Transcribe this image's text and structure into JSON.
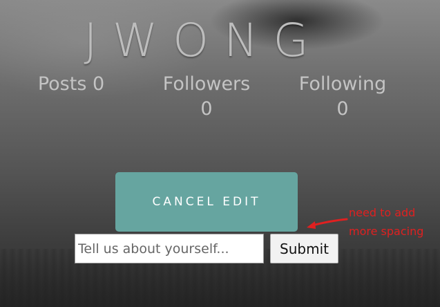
{
  "profile": {
    "username": "JWONG"
  },
  "stats": {
    "posts": {
      "label": "Posts",
      "value": "0"
    },
    "followers": {
      "label": "Followers",
      "value": "0"
    },
    "following": {
      "label": "Following",
      "value": "0"
    }
  },
  "actions": {
    "cancel_edit_label": "CANCEL EDIT",
    "bio_placeholder": "Tell us about yourself...",
    "bio_value": "",
    "submit_label": "Submit"
  },
  "annotation": {
    "line1": "need to add",
    "line2": "more spacing",
    "color": "#e02020"
  },
  "colors": {
    "accent": "#66a5a0"
  }
}
